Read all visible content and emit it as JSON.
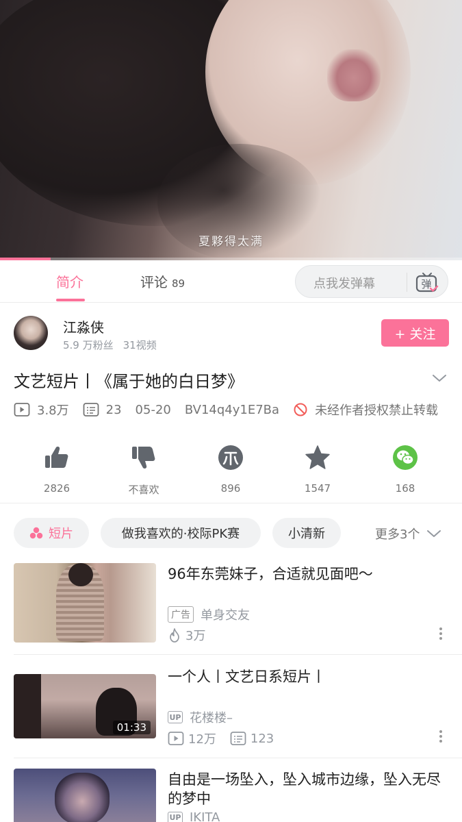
{
  "player": {
    "subtitle": "夏夥得太满",
    "progress": 0.11
  },
  "tabs": {
    "intro_label": "简介",
    "comments_label": "评论",
    "comments_count": "89",
    "danmaku_placeholder": "点我发弹幕",
    "danmaku_icon_char": "弹"
  },
  "uploader": {
    "name": "江淼侠",
    "fans": "5.9 万粉丝",
    "videos": "31视频",
    "follow_label": "+ 关注"
  },
  "video": {
    "title": "文艺短片丨《属于她的白日梦》",
    "views": "3.8万",
    "danmaku_count": "23",
    "date": "05-20",
    "bvid": "BV14q4y1E7Ba",
    "copyright_notice": "未经作者授权禁止转载"
  },
  "actions": {
    "like": "2826",
    "dislike": "不喜欢",
    "coin": "896",
    "favorite": "1547",
    "share": "168"
  },
  "tags": {
    "items": [
      "短片",
      "做我喜欢的·校际PK赛",
      "小清新"
    ],
    "more": "更多3个"
  },
  "recommendations": [
    {
      "title": "96年东莞妹子，合适就见面吧～",
      "ad_badge": "广告",
      "source": "单身交友",
      "heat": "3万"
    },
    {
      "title": "一个人丨文艺日系短片丨",
      "up_badge": "UP",
      "up_name": "花楼楼–",
      "views": "12万",
      "danmaku": "123",
      "duration": "01:33"
    },
    {
      "title": "自由是一场坠入，坠入城市边缘，坠入无尽的梦中",
      "up_badge": "UP",
      "up_name": "IKITA"
    }
  ],
  "colors": {
    "accent": "#fb7299",
    "share_green": "#5dc247",
    "icon_gray": "#61666d"
  }
}
